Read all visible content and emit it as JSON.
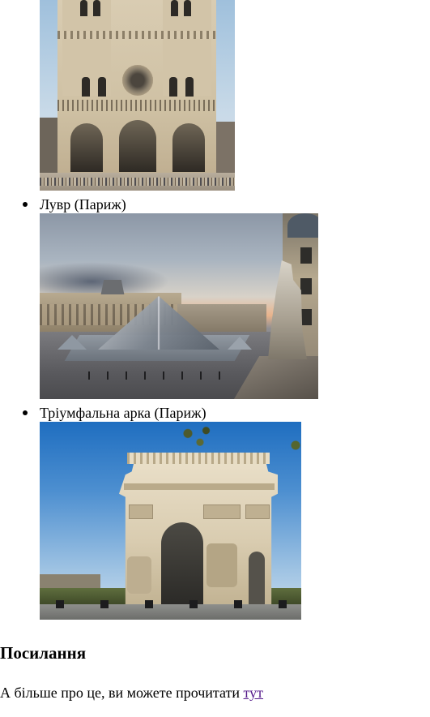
{
  "landmarks": [
    {
      "caption": "",
      "image": "notre-dame-cathedral"
    },
    {
      "caption": "Лувр (Париж)",
      "image": "louvre-pyramid"
    },
    {
      "caption": "Тріумфальна арка (Париж)",
      "image": "arc-de-triomphe"
    }
  ],
  "links_section": {
    "heading": "Посилання",
    "text": "А більше про це, ви можете прочитати ",
    "link_text": "тут"
  },
  "colors": {
    "link_visited": "#551a8b",
    "text": "#000000",
    "background": "#ffffff"
  }
}
